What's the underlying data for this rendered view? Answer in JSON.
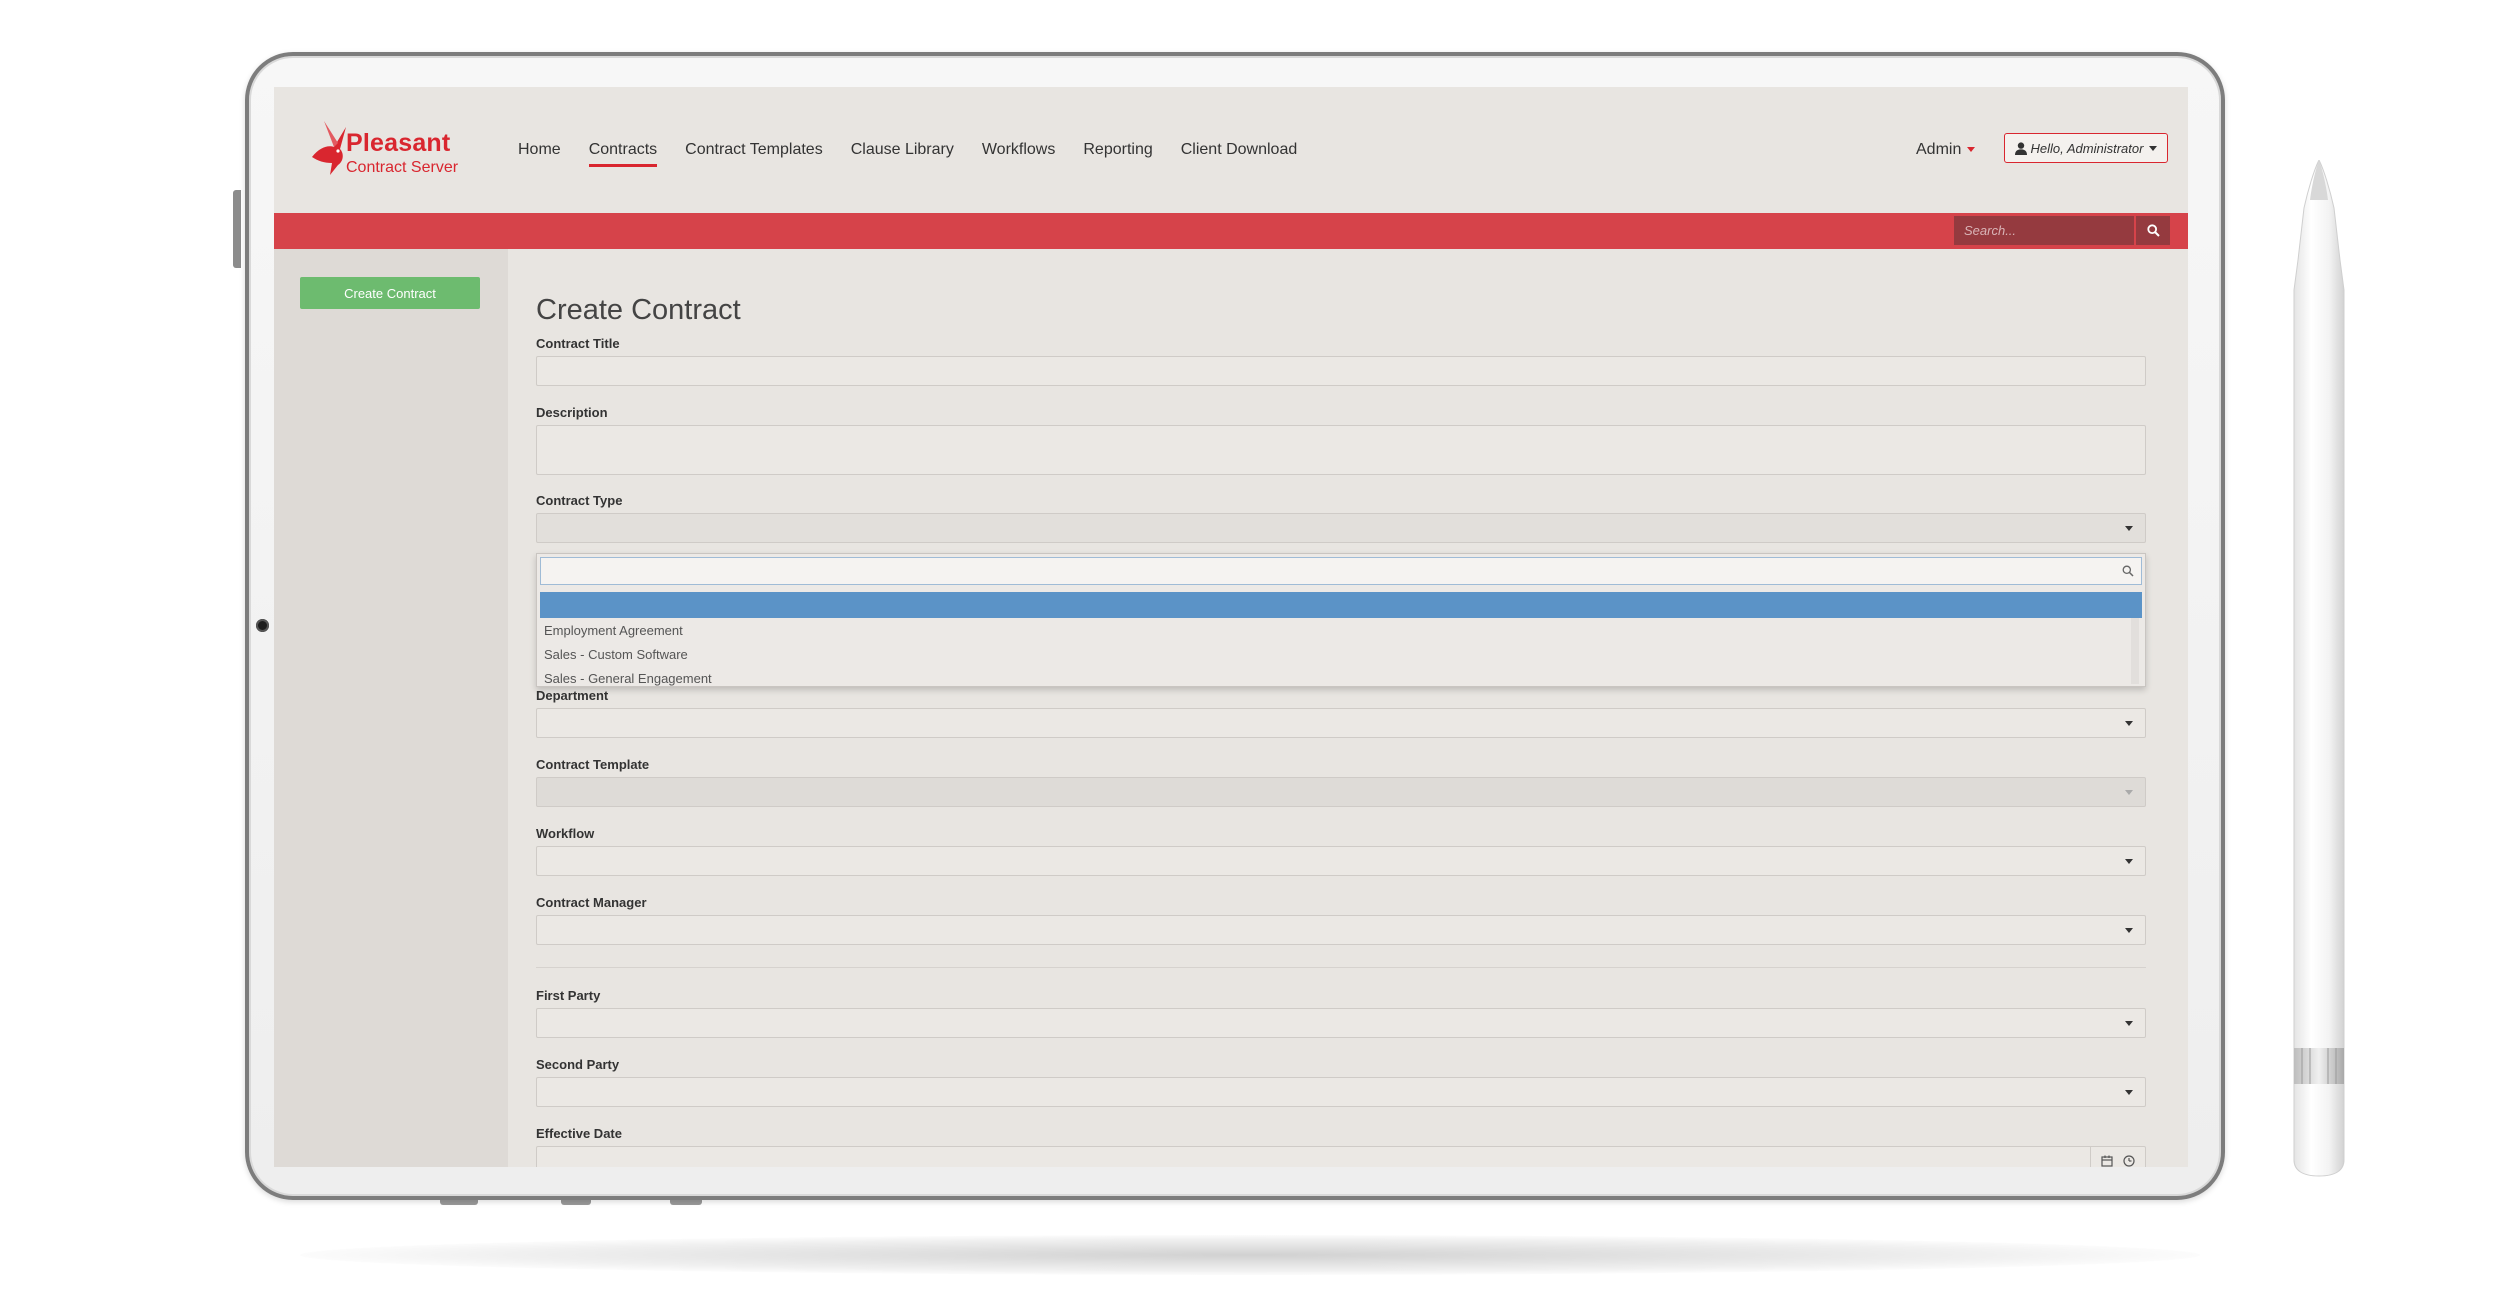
{
  "brand": {
    "name": "Pleasant",
    "subtitle": "Contract Server"
  },
  "nav": {
    "items": [
      {
        "label": "Home",
        "active": false
      },
      {
        "label": "Contracts",
        "active": true
      },
      {
        "label": "Contract Templates",
        "active": false
      },
      {
        "label": "Clause Library",
        "active": false
      },
      {
        "label": "Workflows",
        "active": false
      },
      {
        "label": "Reporting",
        "active": false
      },
      {
        "label": "Client Download",
        "active": false
      }
    ],
    "admin_label": "Admin",
    "user_button_label": "Hello, Administrator"
  },
  "search": {
    "placeholder": "Search..."
  },
  "sidebar": {
    "create_button_label": "Create Contract"
  },
  "form": {
    "title": "Create Contract",
    "labels": {
      "contract_title": "Contract Title",
      "description": "Description",
      "contract_type": "Contract Type",
      "department": "Department",
      "contract_template": "Contract Template",
      "workflow": "Workflow",
      "contract_manager": "Contract Manager",
      "first_party": "First Party",
      "second_party": "Second Party",
      "effective_date": "Effective Date"
    },
    "contract_type_options": [
      "",
      "Employment Agreement",
      "Sales - Custom Software",
      "Sales - General Engagement"
    ]
  },
  "colors": {
    "brand_red": "#d9262f",
    "red_bar": "#d6434a",
    "search_bg": "#953a3f",
    "create_green": "#6dbb6f",
    "dropdown_highlight": "#5b93c7"
  },
  "icons": {
    "search_button": "search-icon",
    "user_button": "user-icon",
    "dropdown_search": "search-icon",
    "date": "calendar-icon",
    "time": "clock-icon"
  }
}
